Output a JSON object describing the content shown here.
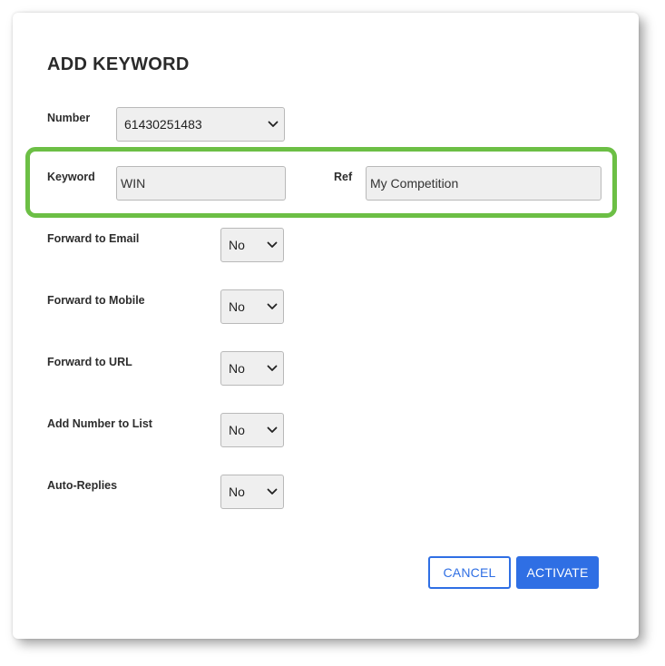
{
  "dialog": {
    "title": "ADD KEYWORD"
  },
  "form": {
    "number": {
      "label": "Number",
      "value": "61430251483"
    },
    "keyword": {
      "label": "Keyword",
      "value": "WIN"
    },
    "ref": {
      "label": "Ref",
      "value": "My Competition"
    },
    "forward_email": {
      "label": "Forward to Email",
      "value": "No"
    },
    "forward_mobile": {
      "label": "Forward to Mobile",
      "value": "No"
    },
    "forward_url": {
      "label": "Forward to URL",
      "value": "No"
    },
    "add_to_list": {
      "label": "Add Number to List",
      "value": "No"
    },
    "auto_replies": {
      "label": "Auto-Replies",
      "value": "No"
    }
  },
  "actions": {
    "cancel_label": "CANCEL",
    "activate_label": "ACTIVATE"
  },
  "colors": {
    "accent": "#2f6fe4",
    "highlight": "#6cbf45",
    "field_bg": "#efefef"
  },
  "icons": {
    "select_arrow": "chevron-down-icon"
  }
}
